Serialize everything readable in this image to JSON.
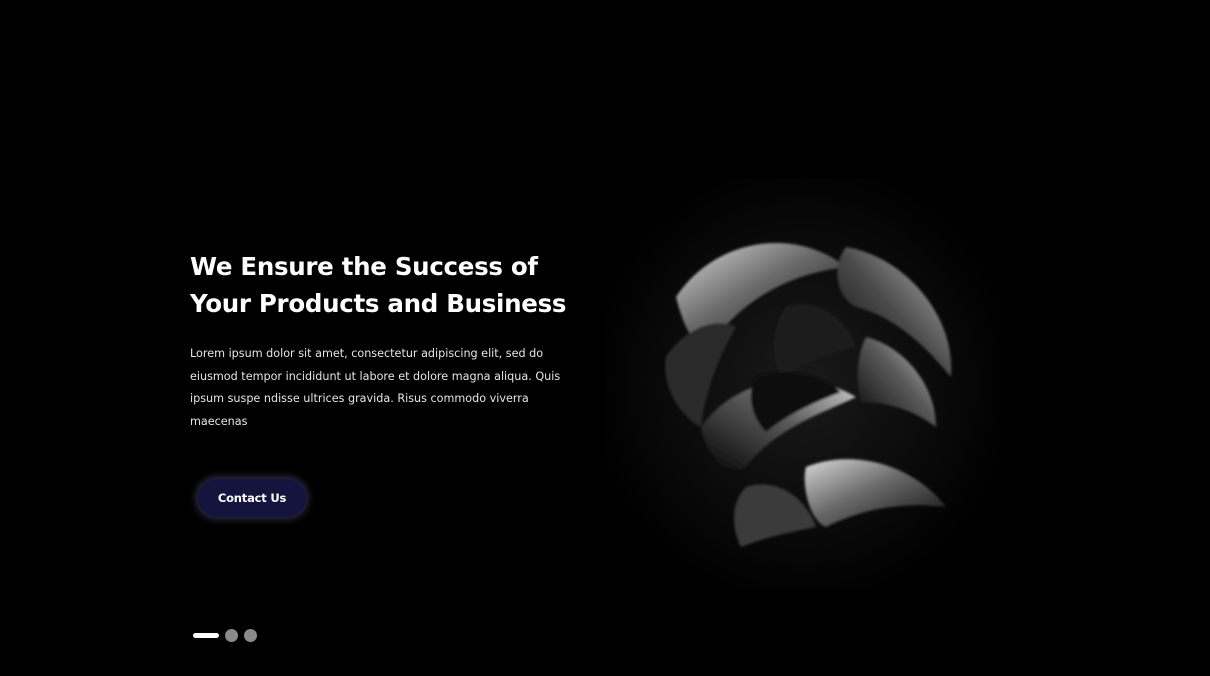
{
  "hero": {
    "title": "We Ensure the Success of Your Products and Business",
    "description": "Lorem ipsum dolor sit amet, consectetur adipiscing elit, sed do eiusmod tempor incididunt ut labore et dolore magna aliqua. Quis ipsum suspe ndisse ultrices gravida. Risus commodo viverra maecenas",
    "cta_label": "Contact Us",
    "image_icon": "abstract-woven-sculpture-image"
  },
  "slider": {
    "slide_count": 3,
    "active_index": 0
  },
  "colors": {
    "background": "#000000",
    "button_bg": "#14143f",
    "text": "#ffffff",
    "dot_inactive": "#8a8a8a"
  }
}
